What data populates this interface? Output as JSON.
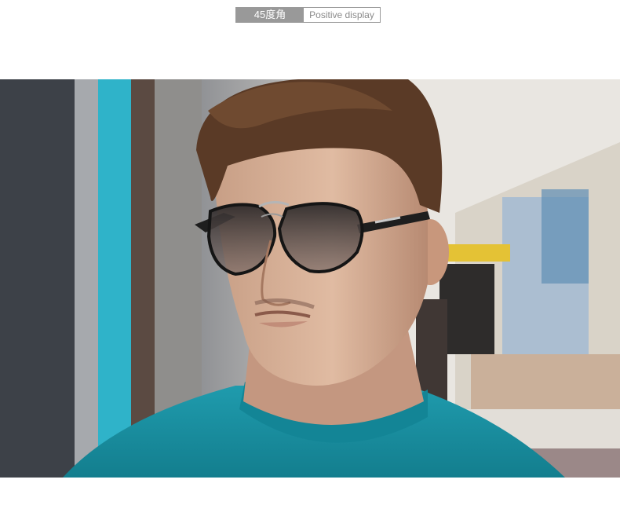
{
  "header": {
    "angle_label": "45度角",
    "view_label": "Positive display"
  }
}
